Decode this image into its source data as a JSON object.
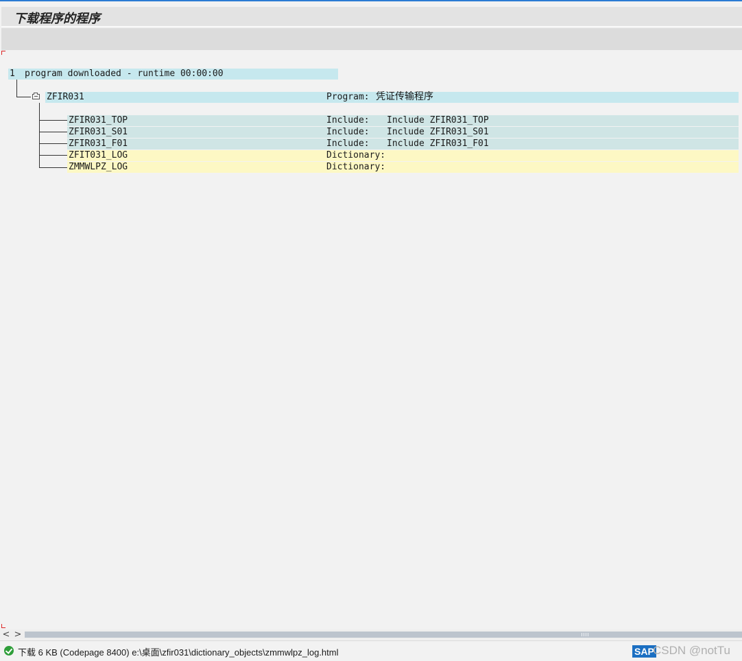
{
  "window": {
    "title": "下载程序的程序"
  },
  "summary": {
    "count": "1",
    "message": "program downloaded - runtime 00:00:00"
  },
  "program": {
    "icon": "folder-icon",
    "name": "ZFIR031",
    "type": "Program:",
    "description": "凭证传输程序"
  },
  "children": [
    {
      "name": "ZFIR031_TOP",
      "type": "Include:",
      "description": "Include ZFIR031_TOP",
      "kind": "include"
    },
    {
      "name": "ZFIR031_S01",
      "type": "Include:",
      "description": "Include ZFIR031_S01",
      "kind": "include"
    },
    {
      "name": "ZFIR031_F01",
      "type": "Include:",
      "description": "Include ZFIR031_F01",
      "kind": "include"
    },
    {
      "name": "ZFIT031_LOG",
      "type": "Dictionary:",
      "description": "",
      "kind": "dictionary"
    },
    {
      "name": "ZMMWLPZ_LOG",
      "type": "Dictionary:",
      "description": "",
      "kind": "dictionary"
    }
  ],
  "scrollbar": {
    "left_arrow": "<",
    "right_arrow": ">"
  },
  "status": {
    "icon": "success-check-icon",
    "message": "下载 6 KB (Codepage 8400) e:\\桌面\\zfir031\\dictionary_objects\\zmmwlpz_log.html"
  },
  "branding": {
    "logo": "SAP",
    "watermark": "CSDN @notTu"
  },
  "colors": {
    "accent": "#2b7bd4",
    "row_highlight": "#c6e8ee",
    "include_row": "#cfe5e5",
    "dictionary_row": "#fdf8c4",
    "success": "#2f9e3a"
  }
}
